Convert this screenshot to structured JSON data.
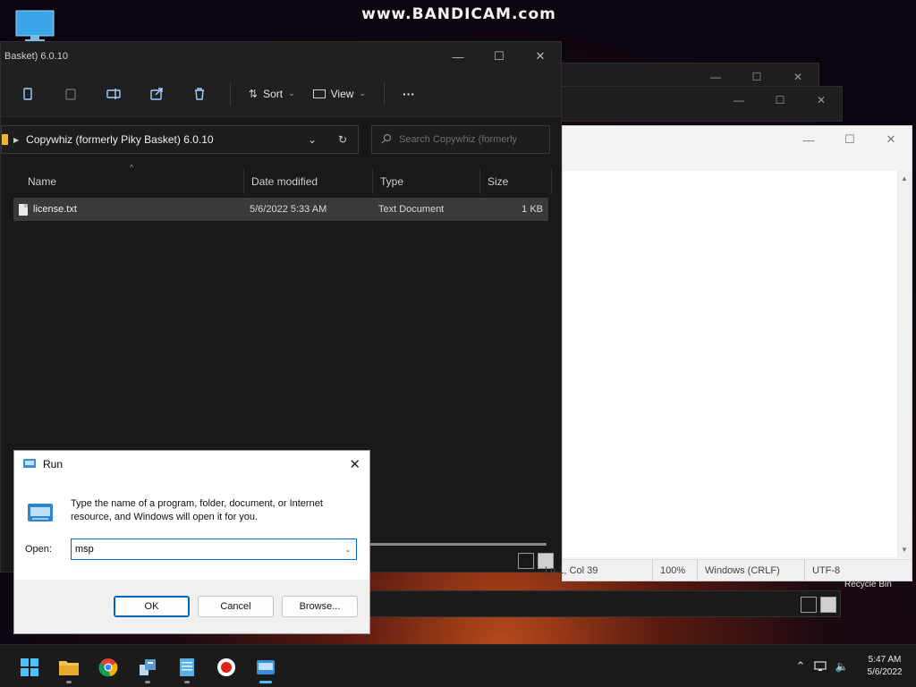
{
  "watermark": "www.BANDICAM.com",
  "explorer": {
    "title": "Basket) 6.0.10",
    "toolbar": {
      "sort_label": "Sort",
      "view_label": "View",
      "more_label": "···",
      "icons": [
        "cut-icon",
        "copy-icon",
        "rename-icon",
        "share-icon",
        "delete-icon"
      ]
    },
    "address_path": "Copywhiz (formerly Piky Basket) 6.0.10",
    "search_placeholder": "Search Copywhiz (formerly",
    "columns": [
      "Name",
      "Date modified",
      "Type",
      "Size"
    ],
    "files": [
      {
        "name": "license.txt",
        "date": "5/6/2022 5:33 AM",
        "type": "Text Document",
        "size": "1 KB"
      }
    ]
  },
  "notepad": {
    "status": {
      "position": "Ln 1, Col 39",
      "zoom": "100%",
      "line_ending": "Windows (CRLF)",
      "encoding": "UTF-8"
    }
  },
  "desktop": {
    "recycle_bin": "Recycle Bin"
  },
  "run_dialog": {
    "title": "Run",
    "description": "Type the name of a program, folder, document, or Internet resource, and Windows will open it for you.",
    "open_label": "Open:",
    "input_value": "msp",
    "buttons": {
      "ok": "OK",
      "cancel": "Cancel",
      "browse": "Browse..."
    }
  },
  "taskbar": {
    "apps": [
      "start-icon",
      "file-explorer-icon",
      "chrome-icon",
      "app-icon",
      "notepad-icon",
      "record-icon",
      "run-icon"
    ],
    "time": "5:47 AM",
    "date": "5/6/2022"
  },
  "colors": {
    "accent": "#0067c0",
    "folder": "#e8b63a",
    "record": "#e0201b"
  }
}
